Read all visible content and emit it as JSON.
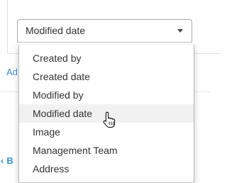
{
  "filter": {
    "select_value": "Modified date"
  },
  "dropdown": {
    "options": [
      "Created by",
      "Created date",
      "Modified by",
      "Modified date",
      "Image",
      "Management Team",
      "Address"
    ],
    "hovered_option": "Modified date"
  },
  "background": {
    "link_text": "Ad",
    "back_text": "B"
  },
  "colors": {
    "link": "#3b8ed8",
    "hover_bg": "#f1f1f1",
    "border": "#aaaaaa"
  },
  "cursor": {
    "icon": "hand-pointer-icon"
  }
}
